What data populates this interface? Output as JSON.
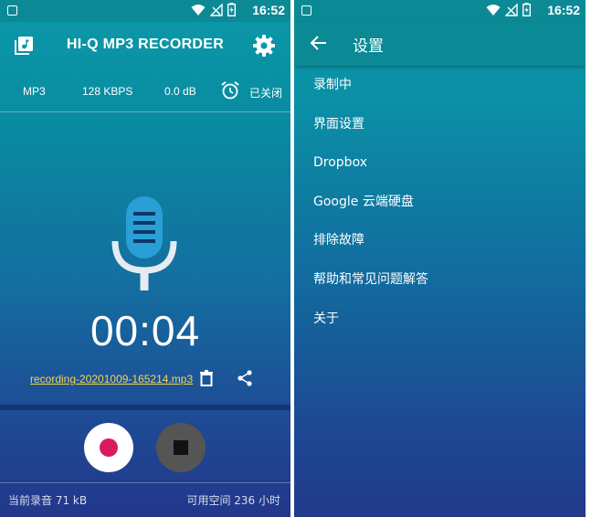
{
  "status_bar": {
    "time": "16:52"
  },
  "recorder": {
    "app_title": "HI-Q MP3 RECORDER",
    "format": "MP3",
    "bitrate": "128 KBPS",
    "gain": "0.0 dB",
    "timer_status": "已关闭",
    "elapsed": "00:04",
    "file_name": "recording-20201009-165214.mp3",
    "current_recording": "当前录音 71 kB",
    "free_space": "可用空间 236 小时",
    "icons": {
      "library": "library-music-icon",
      "settings": "gear-icon",
      "alarm": "alarm-clock-icon",
      "mic": "microphone-icon",
      "trash": "trash-icon",
      "share": "share-icon",
      "record": "record-icon",
      "stop": "stop-icon"
    },
    "colors": {
      "record_dot": "#d81b60",
      "file_link": "#f5d64a"
    }
  },
  "settings": {
    "title": "设置",
    "items": [
      {
        "label": "录制中"
      },
      {
        "label": "界面设置"
      },
      {
        "label": "Dropbox"
      },
      {
        "label": "Google 云端硬盘"
      },
      {
        "label": "排除故障"
      },
      {
        "label": "帮助和常见问题解答"
      },
      {
        "label": "关于"
      }
    ]
  }
}
